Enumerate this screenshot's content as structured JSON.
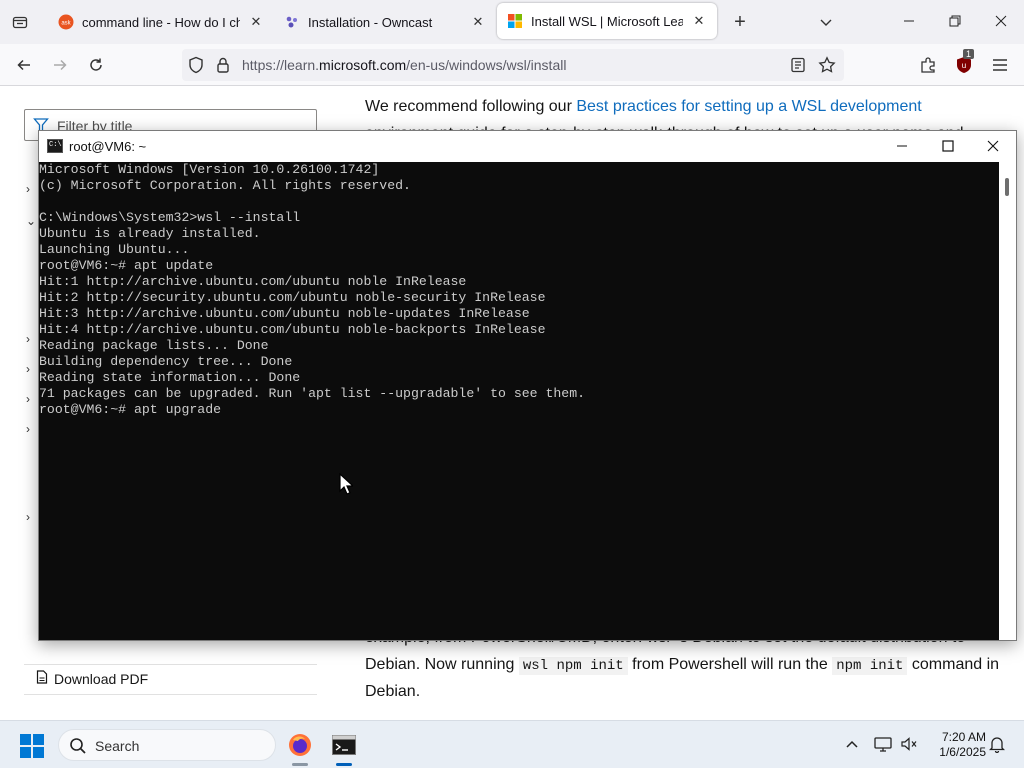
{
  "browser": {
    "tabs": [
      {
        "title": "command line - How do I chec",
        "favicon": "askubuntu-icon",
        "active": false
      },
      {
        "title": "Installation - Owncast",
        "favicon": "owncast-icon",
        "active": false
      },
      {
        "title": "Install WSL | Microsoft Learn",
        "favicon": "microsoft-icon",
        "active": true
      }
    ],
    "url_prefix": "https://learn.",
    "url_domain": "microsoft.com",
    "url_path": "/en-us/windows/wsl/install",
    "extension_badge": "1"
  },
  "page": {
    "filter_placeholder": "Filter by title",
    "intro_text": "We recommend following our ",
    "intro_link": "Best practices for setting up a WSL development",
    "intro_line2_partial": "environment guide for a step-by-step walk-through of how to set up a user name and",
    "bottom_line1_partial": "example, from PowerShell/CMD, enter: wsl -s Debian to set the default distribution to",
    "bottom_line2_a": "Debian. Now running ",
    "bottom_code1": "wsl npm init",
    "bottom_line2_b": " from Powershell will run the ",
    "bottom_code2": "npm init",
    "bottom_line2_c": " command in",
    "bottom_line3": "Debian.",
    "download_pdf": "Download PDF"
  },
  "terminal": {
    "title": "root@VM6: ~",
    "lines": [
      "Microsoft Windows [Version 10.0.26100.1742]",
      "(c) Microsoft Corporation. All rights reserved.",
      "",
      "C:\\Windows\\System32>wsl --install",
      "Ubuntu is already installed.",
      "Launching Ubuntu...",
      "root@VM6:~# apt update",
      "Hit:1 http://archive.ubuntu.com/ubuntu noble InRelease",
      "Hit:2 http://security.ubuntu.com/ubuntu noble-security InRelease",
      "Hit:3 http://archive.ubuntu.com/ubuntu noble-updates InRelease",
      "Hit:4 http://archive.ubuntu.com/ubuntu noble-backports InRelease",
      "Reading package lists... Done",
      "Building dependency tree... Done",
      "Reading state information... Done",
      "71 packages can be upgraded. Run 'apt list --upgradable' to see them.",
      "root@VM6:~# apt upgrade"
    ]
  },
  "taskbar": {
    "search_label": "Search",
    "time": "7:20 AM",
    "date": "1/6/2025"
  },
  "colors": {
    "link": "#0f6cbd",
    "terminal_bg": "#0c0c0c",
    "terminal_fg": "#cccccc",
    "taskbar_bg": "#e8eef5"
  }
}
